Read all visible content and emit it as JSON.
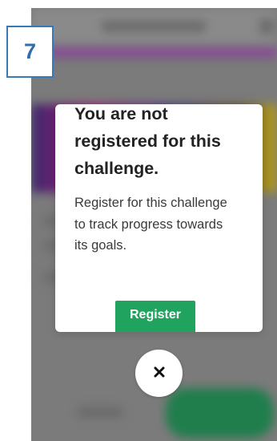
{
  "step_badge": {
    "number": "7"
  },
  "modal": {
    "title": "You are not registered for this challenge.",
    "body": "Register for this challenge to track progress towards its goals.",
    "register_label": "Register"
  },
  "close_button": {
    "icon": "close-icon"
  },
  "colors": {
    "primary_green": "#1fa35f",
    "badge_blue": "#3b78b8",
    "overlay_gray": "#7b7b7b"
  }
}
